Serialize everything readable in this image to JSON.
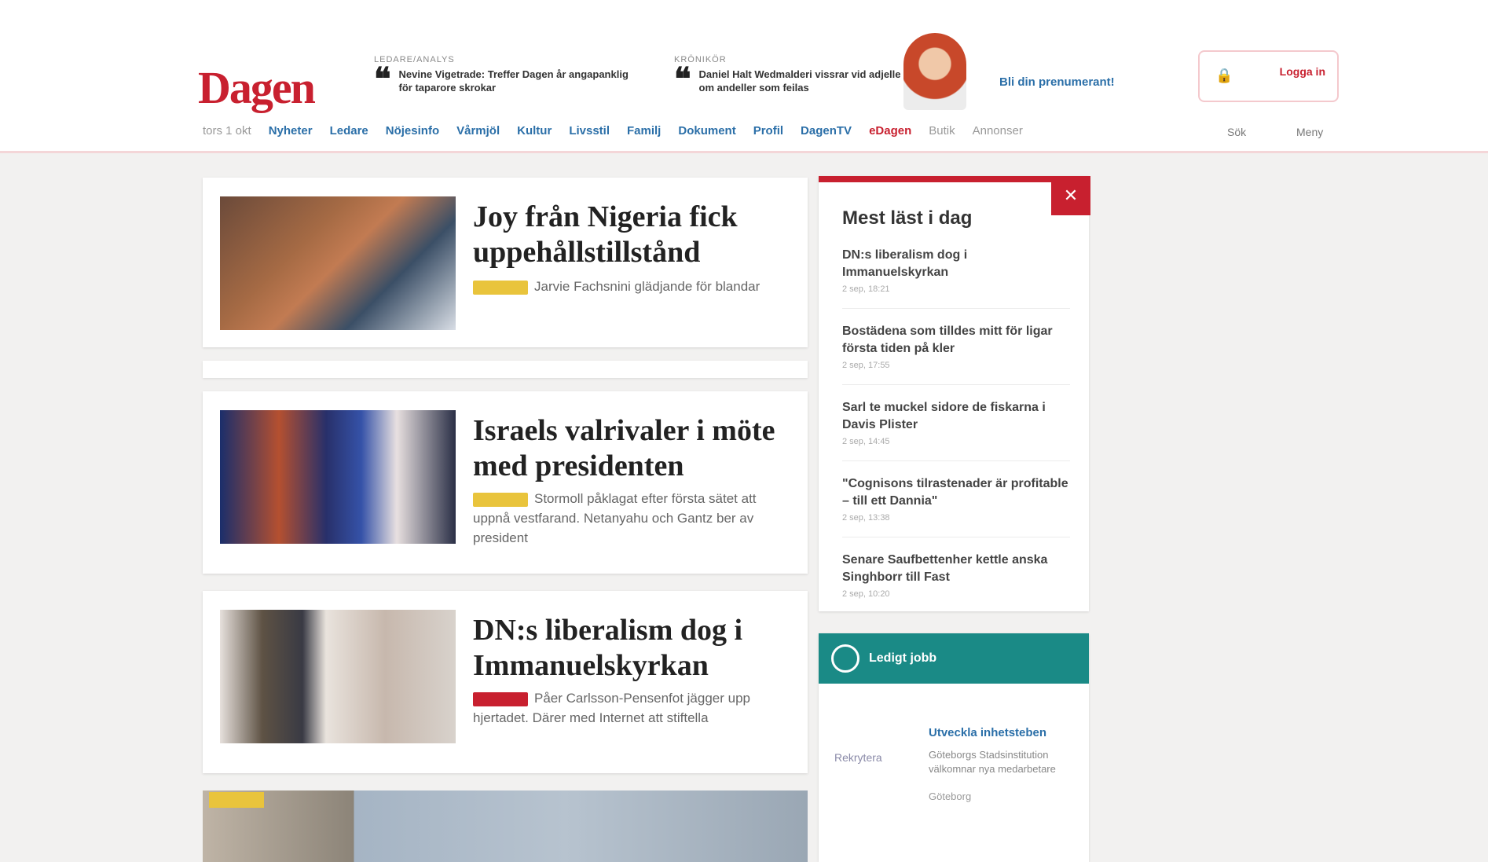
{
  "header": {
    "logo": "Dagen",
    "promo1": {
      "kicker": "LEDARE/ANALYS",
      "text": "Nevine Vigetrade: Treffer Dagen år angapanklig för taparore skrokar"
    },
    "promo2": {
      "kicker": "KRÖNIKÖR",
      "text": "Daniel Halt Wedmalderi vissrar vid adjelle om andeller som feilas"
    },
    "promo_link": "Bli din prenumerant!",
    "login": {
      "lock_icon": "🔒",
      "label": "Logga in"
    }
  },
  "nav": {
    "date": "tors 1 okt",
    "items": [
      "Nyheter",
      "Ledare",
      "Nöjesinfo",
      "Vårmjöl",
      "Kultur",
      "Livsstil",
      "Familj",
      "Dokument",
      "Profil",
      "DagenTV",
      "eDagen",
      "Butik",
      "Annonser"
    ],
    "right1": "Sök",
    "right2": "Meny"
  },
  "articles": [
    {
      "title": "Joy från Nigeria fick uppehållstillstånd",
      "desc": "Jarvie Fachsnini glädjande för blandar"
    },
    {
      "title": "Israels valrivaler i möte med presidenten",
      "desc": "Stormoll påklagat efter första sätet att uppnå vestfarand. Netanyahu och Gantz ber av president"
    },
    {
      "title": "DN:s liberalism dog i Immanuelskyrkan",
      "desc": "Påer Carlsson-Pensenfot jägger upp hjertadet. Därer med Internet att stiftella"
    }
  ],
  "sidebar": {
    "title": "Mest läst i dag",
    "close_icon": "✕",
    "items": [
      {
        "title": "DN:s liberalism dog i Immanuelskyrkan",
        "date": "2 sep, 18:21"
      },
      {
        "title": "Bostädena som tilldes mitt för ligar första tiden på kler",
        "date": "2 sep, 17:55"
      },
      {
        "title": "Sarl te muckel sidore de fiskarna i Davis Plister",
        "date": "2 sep, 14:45"
      },
      {
        "title": "\"Cognisons tilrastenader är profitable – till ett Dannia\"",
        "date": "2 sep, 13:38"
      },
      {
        "title": "Senare Saufbettenher kettle anska Singhborr till Fast",
        "date": "2 sep, 10:20"
      }
    ]
  },
  "ad": {
    "head_label": "Ledigt jobb",
    "brand": "Rekrytera",
    "link": "Utveckla inhetsteben",
    "sub": "Göteborgs Stadsinstitution välkomnar nya medarbetare",
    "location": "Göteborg"
  }
}
